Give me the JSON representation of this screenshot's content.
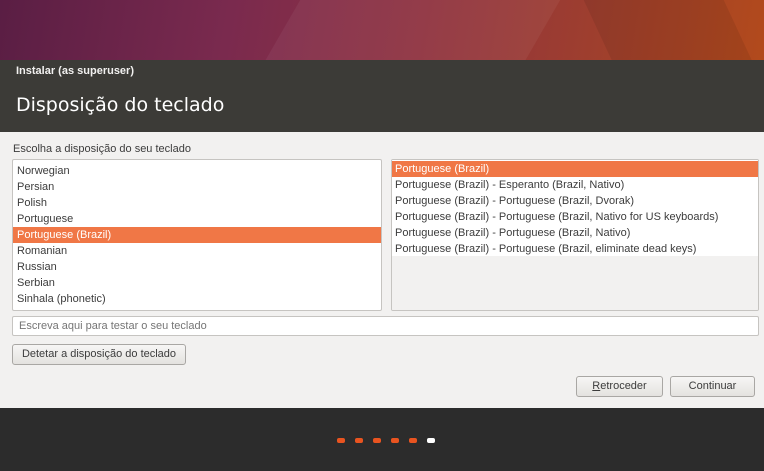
{
  "window": {
    "title": "Instalar (as superuser)"
  },
  "page": {
    "title": "Disposição do teclado",
    "prompt": "Escolha a disposição do seu teclado"
  },
  "layouts": {
    "items": [
      "Norwegian",
      "Persian",
      "Polish",
      "Portuguese",
      "Portuguese (Brazil)",
      "Romanian",
      "Russian",
      "Serbian",
      "Sinhala (phonetic)"
    ],
    "selected": "Portuguese (Brazil)"
  },
  "variants": {
    "items": [
      "Portuguese (Brazil)",
      "Portuguese (Brazil) - Esperanto (Brazil, Nativo)",
      "Portuguese (Brazil) - Portuguese (Brazil, Dvorak)",
      "Portuguese (Brazil) - Portuguese (Brazil, Nativo for US keyboards)",
      "Portuguese (Brazil) - Portuguese (Brazil, Nativo)",
      "Portuguese (Brazil) - Portuguese (Brazil, eliminate dead keys)"
    ],
    "selected": "Portuguese (Brazil)"
  },
  "test_input": {
    "placeholder": "Escreva aqui para testar o seu teclado",
    "value": ""
  },
  "buttons": {
    "detect": "Detetar a disposição do teclado",
    "back_mnemonic": "R",
    "back_rest": "etroceder",
    "continue": "Continuar"
  },
  "progress": {
    "total_steps": 6,
    "current_step": 6
  },
  "colors": {
    "accent": "#f07746",
    "header_bg": "#3c3b37",
    "footer_bg": "#2c2c2c",
    "progress_dot": "#e95420"
  }
}
